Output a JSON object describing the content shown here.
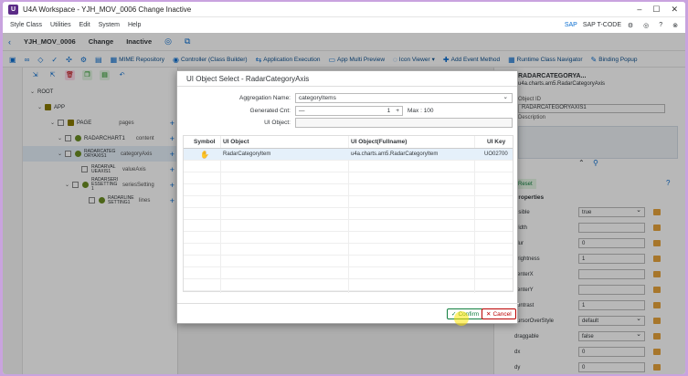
{
  "window": {
    "title": "U4A Workspace - YJH_MOV_0006 Change Inactive",
    "logo": "U"
  },
  "menu": {
    "items": [
      "Style Class",
      "Utilities",
      "Edit",
      "System",
      "Help"
    ],
    "tcode_label": "SAP T-CODE"
  },
  "header": {
    "app_id": "YJH_MOV_0006",
    "mode": "Change",
    "status": "Inactive"
  },
  "toolbar": {
    "items": [
      "MIME Repository",
      "Controller (Class Builder)",
      "Application Execution",
      "App Multi Preview",
      "Icon Viewer",
      "Add Event Method",
      "Runtime Class Navigator",
      "Binding Popup"
    ]
  },
  "tree": {
    "root": "ROOT",
    "rows": [
      {
        "name": "APP",
        "agg": ""
      },
      {
        "name": "PAGE",
        "agg": "pages"
      },
      {
        "name": "RADARCHART1",
        "agg": "content"
      },
      {
        "name": "RADARCATEGORYAXIS1",
        "agg": "categoryAxis"
      },
      {
        "name": "RADARVALUEAXIS1",
        "agg": "valueAxis"
      },
      {
        "name": "RADARSERIESSETTING1",
        "agg": "seriesSetting"
      },
      {
        "name": "RADARLINESETTING1",
        "agg": "lines"
      }
    ]
  },
  "right": {
    "title": "RADARCATEGORYA...",
    "class": "u4a.charts.am5.RadarCategoryAxis",
    "obj_id_label": "Object ID",
    "obj_id": "RADARCATEGORYAXIS1",
    "desc_label": "Description",
    "reset": "Reset",
    "props_label": "Properties",
    "props": [
      {
        "label": "visible",
        "value": "true",
        "dd": true
      },
      {
        "label": "width",
        "value": "",
        "dd": false
      },
      {
        "label": "blur",
        "value": "0",
        "dd": false
      },
      {
        "label": "brightness",
        "value": "1",
        "dd": false
      },
      {
        "label": "centerX",
        "value": "",
        "dd": false
      },
      {
        "label": "centerY",
        "value": "",
        "dd": false
      },
      {
        "label": "contrast",
        "value": "1",
        "dd": false
      },
      {
        "label": "cursorOverStyle",
        "value": "default",
        "dd": true
      },
      {
        "label": "draggable",
        "value": "false",
        "dd": true
      },
      {
        "label": "dx",
        "value": "0",
        "dd": false
      },
      {
        "label": "dy",
        "value": "0",
        "dd": false
      }
    ]
  },
  "dialog": {
    "title": "UI Object Select - RadarCategoryAxis",
    "agg_label": "Aggregation Name:",
    "agg_value": "categoryItems",
    "gen_label": "Generated Cnt:",
    "gen_value": "1",
    "max_label": "Max : 100",
    "uiobj_label": "UI Object:",
    "columns": [
      "Symbol",
      "UI Object",
      "UI Object(Fullname)",
      "UI Key"
    ],
    "rows": [
      {
        "symbol": "",
        "object": "RadarCategoryItem",
        "fullname": "u4a.charts.am5.RadarCategoryItem",
        "key": "UO02700"
      }
    ],
    "confirm": "Confirm",
    "cancel": "Cancel"
  }
}
